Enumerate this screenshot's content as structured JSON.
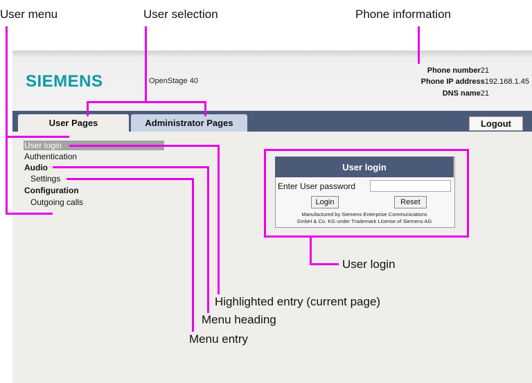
{
  "annotations": {
    "user_menu": "User menu",
    "user_selection": "User selection",
    "phone_information": "Phone information",
    "user_login": "User login",
    "highlighted_entry": "Highlighted entry (current page)",
    "menu_heading": "Menu heading",
    "menu_entry": "Menu entry"
  },
  "header": {
    "logo": "SIEMENS",
    "model": "OpenStage 40",
    "phone_number_label": "Phone number",
    "phone_number": "21",
    "ip_label": "Phone IP address",
    "ip": "192.168.1.45",
    "dns_label": "DNS name",
    "dns": "21"
  },
  "tabs": {
    "user": "User Pages",
    "admin": "Administrator Pages",
    "logout": "Logout"
  },
  "menu": {
    "user_login": "User login",
    "authentication": "Authentication",
    "audio": "Audio",
    "settings": "Settings",
    "configuration": "Configuration",
    "outgoing_calls": "Outgoing calls"
  },
  "login": {
    "title": "User login",
    "password_label": "Enter User password",
    "password_value": "",
    "login_button": "Login",
    "reset_button": "Reset",
    "footer_line1": "Manufactured by Siemens Enterprise Communications",
    "footer_line2": "GmbH & Co. KG under Trademark License of Siemens AG"
  },
  "colors": {
    "callout": "#e800e8",
    "navbar": "#4c5a7a",
    "logo": "#0d9aa6"
  }
}
